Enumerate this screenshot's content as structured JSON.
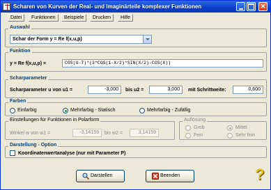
{
  "window": {
    "title": "Scharen von Kurven der Real- und Imaginärteile komplexer Funktionen"
  },
  "menu": [
    "Datei",
    "Funktionen",
    "Beispiele",
    "Drucken",
    "Hilfe"
  ],
  "auswahl": {
    "legend": "Auswahl",
    "selected": "Schar der Form y = Re f(x,u,p)"
  },
  "funktion": {
    "legend": "Funktion",
    "label": "y = Re f(x,u,p) =",
    "value": "COS(U-7)*(3*COS(1-X/2)*SIN(X/2)-COS(X))"
  },
  "scharparameter": {
    "legend": "Scharparameter",
    "label_u1": "Scharparameter u von u1 =",
    "u1": "-3,000",
    "label_u2": "bis u2 =",
    "u2": "3,000",
    "label_step": "mit Schrittweite:",
    "step": "0,600"
  },
  "farben": {
    "legend": "Farben",
    "options": [
      "Einfarbig",
      "Mehrfarbig - Statisch",
      "Mehrfarbig - Zufällig"
    ],
    "selected_index": 1
  },
  "polarform": {
    "legend": "Einstellungen für Funktionen in Polarform",
    "label_w1": "Winkel w von w1 =",
    "w1": "-3,14159",
    "label_w2": "bis w2 =",
    "w2": "3,14159"
  },
  "aufloesung": {
    "legend": "Auflösung",
    "options": [
      "Grob",
      "Mittel",
      "Fein",
      "Sehr fein"
    ],
    "selected_index": 1
  },
  "darstellung": {
    "legend": "Darstellung - Option",
    "checkbox_label": "Koordinatenwertanalyse (nur mit Parameter P)",
    "checked": false
  },
  "buttons": {
    "darstellen": "Darstellen",
    "beenden": "Beenden"
  },
  "help": {
    "symbol": "?"
  }
}
